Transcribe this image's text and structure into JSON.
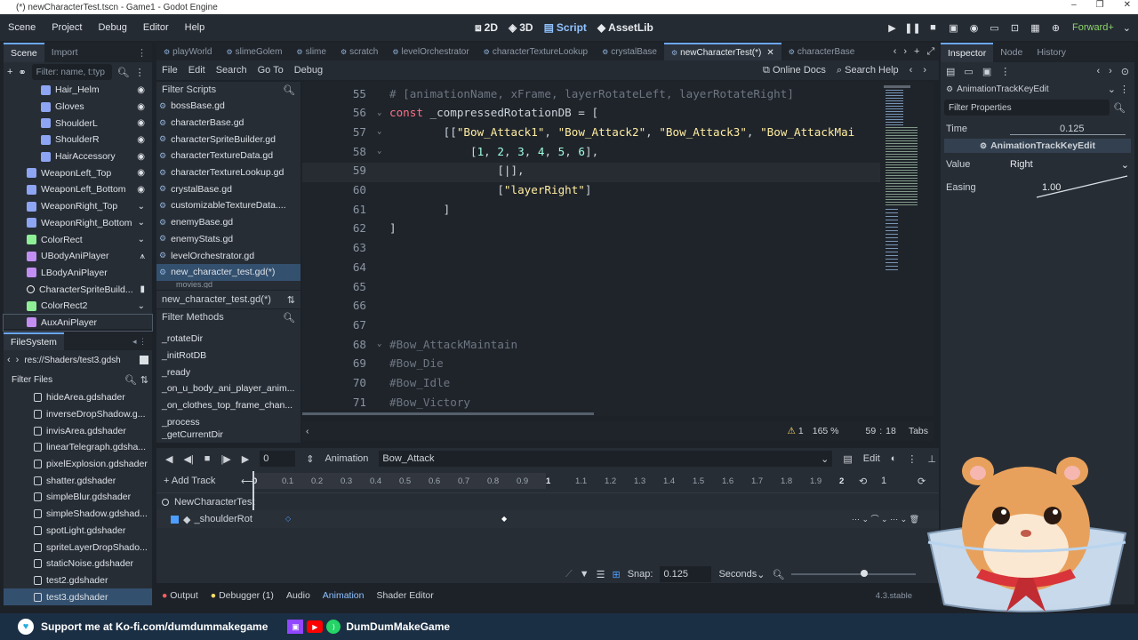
{
  "window": {
    "title": "(*) newCharacterTest.tscn - Game1 - Godot Engine",
    "controls": [
      "–",
      "❐",
      "✕"
    ]
  },
  "menu": {
    "items": [
      "Scene",
      "Project",
      "Debug",
      "Editor",
      "Help"
    ],
    "modes": [
      "2D",
      "3D",
      "Script",
      "AssetLib"
    ],
    "renderer": "Forward+"
  },
  "scene_dock": {
    "tabs": [
      "Scene",
      "Import"
    ],
    "filter_placeholder": "Filter: name, t:typ",
    "nodes": [
      {
        "label": "Hair_Helm",
        "color": "#8da5f3",
        "indent": 1,
        "right": "eye"
      },
      {
        "label": "Gloves",
        "color": "#8da5f3",
        "indent": 1,
        "right": "eye"
      },
      {
        "label": "ShoulderL",
        "color": "#8da5f3",
        "indent": 1,
        "right": "eye"
      },
      {
        "label": "ShoulderR",
        "color": "#8da5f3",
        "indent": 1,
        "right": "eye"
      },
      {
        "label": "HairAccessory",
        "color": "#8da5f3",
        "indent": 1,
        "right": "eye"
      },
      {
        "label": "WeaponLeft_Top",
        "color": "#8da5f3",
        "indent": 0,
        "right": "eye"
      },
      {
        "label": "WeaponLeft_Bottom",
        "color": "#8da5f3",
        "indent": 0,
        "right": "eye"
      },
      {
        "label": "WeaponRight_Top",
        "color": "#8da5f3",
        "indent": 0,
        "right": "fold"
      },
      {
        "label": "WeaponRight_Bottom",
        "color": "#8da5f3",
        "indent": 0,
        "right": "fold"
      },
      {
        "label": "ColorRect",
        "color": "#8eef97",
        "indent": 0,
        "right": "fold"
      },
      {
        "label": "UBodyAniPlayer",
        "color": "#c38ef1",
        "indent": 0,
        "right": "signal"
      },
      {
        "label": "LBodyAniPlayer",
        "color": "#c38ef1",
        "indent": 0,
        "right": ""
      },
      {
        "label": "CharacterSpriteBuild...",
        "color": "#ffffff",
        "indent": 0,
        "right": "script"
      },
      {
        "label": "ColorRect2",
        "color": "#8eef97",
        "indent": 0,
        "right": "fold"
      },
      {
        "label": "AuxAniPlayer",
        "color": "#c38ef1",
        "indent": 0,
        "right": ""
      }
    ]
  },
  "filesystem": {
    "title": "FileSystem",
    "path": "res://Shaders/test3.gdsh",
    "filter_placeholder": "Filter Files",
    "files": [
      "hideArea.gdshader",
      "inverseDropShadow.g...",
      "invisArea.gdshader",
      "linearTelegraph.gdsha...",
      "pixelExplosion.gdshader",
      "shatter.gdshader",
      "simpleBlur.gdshader",
      "simpleShadow.gdshad...",
      "spotLight.gdshader",
      "spriteLayerDropShado...",
      "staticNoise.gdshader",
      "test2.gdshader",
      "test3.gdshader"
    ]
  },
  "script_tabs": [
    "playWorld",
    "slimeGolem",
    "slime",
    "scratch",
    "levelOrchestrator",
    "characterTextureLookup",
    "crystalBase",
    "newCharacterTest(*)",
    "characterBase"
  ],
  "script_menu": {
    "items": [
      "File",
      "Edit",
      "Search",
      "Go To",
      "Debug"
    ],
    "online_docs": "Online Docs",
    "search_help": "Search Help"
  },
  "script_list": {
    "filter_placeholder": "Filter Scripts",
    "items": [
      "bossBase.gd",
      "characterBase.gd",
      "characterSpriteBuilder.gd",
      "characterTextureData.gd",
      "characterTextureLookup.gd",
      "crystalBase.gd",
      "customizableTextureData....",
      "enemyBase.gd",
      "enemyStats.gd",
      "levelOrchestrator.gd",
      "new_character_test.gd(*)"
    ],
    "partial": "movies.gd",
    "current": "new_character_test.gd(*)"
  },
  "methods": {
    "filter_placeholder": "Filter Methods",
    "items": [
      "_rotateDir",
      "_initRotDB",
      "_ready",
      "_on_u_body_ani_player_anim...",
      "_on_clothes_top_frame_chan...",
      "_process",
      "_getCurrentDir"
    ]
  },
  "code": {
    "lines": [
      {
        "n": "55",
        "fold": false,
        "html": "<span class=\"cm\"># [animationName, xFrame, layerRotateLeft, layerRotateRight]</span>"
      },
      {
        "n": "56",
        "fold": true,
        "html": "<span class=\"kw\">const</span> _compressedRotationDB = ["
      },
      {
        "n": "57",
        "fold": true,
        "html": "        [[<span class=\"str\">\"Bow_Attack1\"</span>, <span class=\"str\">\"Bow_Attack2\"</span>, <span class=\"str\">\"Bow_Attack3\"</span>, <span class=\"str\">\"Bow_AttackMai</span>"
      },
      {
        "n": "58",
        "fold": true,
        "html": "            [<span class=\"num\">1</span>, <span class=\"num\">2</span>, <span class=\"num\">3</span>, <span class=\"num\">4</span>, <span class=\"num\">5</span>, <span class=\"num\">6</span>],"
      },
      {
        "n": "59",
        "fold": false,
        "html": "                [|],"
      },
      {
        "n": "60",
        "fold": false,
        "html": "                [<span class=\"str\">\"layerRight\"</span>]"
      },
      {
        "n": "61",
        "fold": false,
        "html": "        ]"
      },
      {
        "n": "62",
        "fold": false,
        "html": "]"
      },
      {
        "n": "63",
        "fold": false,
        "html": ""
      },
      {
        "n": "64",
        "fold": false,
        "html": ""
      },
      {
        "n": "65",
        "fold": false,
        "html": ""
      },
      {
        "n": "66",
        "fold": false,
        "html": ""
      },
      {
        "n": "67",
        "fold": false,
        "html": ""
      },
      {
        "n": "68",
        "fold": true,
        "html": "<span class=\"cm\">#Bow_AttackMaintain</span>"
      },
      {
        "n": "69",
        "fold": false,
        "html": "<span class=\"cm\">#Bow_Die</span>"
      },
      {
        "n": "70",
        "fold": false,
        "html": "<span class=\"cm\">#Bow_Idle</span>"
      },
      {
        "n": "71",
        "fold": false,
        "html": "<span class=\"cm\">#Bow_Victory</span>"
      }
    ]
  },
  "status": {
    "warnings": "1",
    "zoom": "165 %",
    "line": "59",
    "col": "18",
    "indent": "Tabs"
  },
  "animation": {
    "frame": "0",
    "label": "Animation",
    "name": "Bow_Attack",
    "edit": "Edit",
    "add_track": "Add Track",
    "node": "NewCharacterTest",
    "track": "_shoulderRot",
    "ruler": [
      "0",
      "0.1",
      "0.2",
      "0.3",
      "0.4",
      "0.5",
      "0.6",
      "0.7",
      "0.8",
      "0.9",
      "1",
      "1.1",
      "1.2",
      "1.3",
      "1.4",
      "1.5",
      "1.6",
      "1.7",
      "1.8",
      "1.9",
      "2"
    ],
    "length": "1",
    "snap_label": "Snap:",
    "snap": "0.125",
    "unit": "Seconds"
  },
  "bottom_tabs": {
    "output": "Output",
    "debugger": "Debugger (1)",
    "audio": "Audio",
    "animation": "Animation",
    "shader": "Shader Editor",
    "version": "4.3.stable"
  },
  "inspector": {
    "tabs": [
      "Inspector",
      "Node",
      "History"
    ],
    "object": "AnimationTrackKeyEdit",
    "filter_placeholder": "Filter Properties",
    "time_label": "Time",
    "time": "0.125",
    "section": "AnimationTrackKeyEdit",
    "value_label": "Value",
    "value": "Right",
    "easing_label": "Easing",
    "easing": "1.00"
  },
  "banner": {
    "kofi": "Support me at Ko-fi.com/dumdummakegame",
    "channel": "DumDumMakeGame"
  }
}
